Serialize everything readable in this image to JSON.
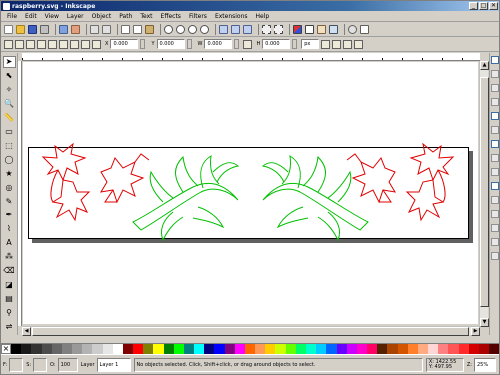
{
  "window": {
    "title": "raspberry.svg - Inkscape",
    "minimize_label": "_",
    "maximize_label": "□",
    "close_label": "✕"
  },
  "menu": [
    "File",
    "Edit",
    "View",
    "Layer",
    "Object",
    "Path",
    "Text",
    "Effects",
    "Filters",
    "Extensions",
    "Help"
  ],
  "toolbox": [
    "selector-tool",
    "node-tool",
    "tweak-tool",
    "zoom-tool",
    "measure-tool",
    "rect-tool",
    "box-3d-tool",
    "circle-tool",
    "star-tool",
    "spiral-tool",
    "pencil-tool",
    "pen-tool",
    "calligraphy-tool",
    "text-tool",
    "spray-tool",
    "eraser-tool",
    "bucket-tool",
    "gradient-tool",
    "dropper-tool",
    "connector-tool"
  ],
  "toolbox_glyphs": [
    "➤",
    "⬉",
    "✧",
    "🔍",
    "📏",
    "▭",
    "⬚",
    "◯",
    "★",
    "◎",
    "✎",
    "✒",
    "⌇",
    "A",
    "⁂",
    "⌫",
    "◪",
    "▤",
    "⚲",
    "⇌"
  ],
  "controls": {
    "x_label": "X",
    "x_value": "0.000",
    "y_label": "Y",
    "y_value": "0.000",
    "w_label": "W",
    "w_value": "0.000",
    "h_label": "H",
    "h_value": "0.000",
    "unit": "px"
  },
  "status": {
    "layer_label": "Layer",
    "layer_value": "Layer 1",
    "message": "No objects selected. Click, Shift+click, or drag around objects to select.",
    "coords_x": "X: 1422.55",
    "coords_y": "Y: 497.95",
    "zoom": "25%",
    "fill_label": "F:",
    "stroke_label": "S:",
    "opacity_label": "O:",
    "opacity_value": "100"
  },
  "colors": {
    "title_bar": "#0a246a",
    "flower_red": "#e00000",
    "leaf_green": "#00c000"
  },
  "palette": [
    "#000000",
    "#1a1a1a",
    "#333333",
    "#4d4d4d",
    "#666666",
    "#808080",
    "#999999",
    "#b3b3b3",
    "#cccccc",
    "#e6e6e6",
    "#ffffff",
    "#800000",
    "#ff0000",
    "#808000",
    "#ffff00",
    "#008000",
    "#00ff00",
    "#008080",
    "#00ffff",
    "#000080",
    "#0000ff",
    "#800080",
    "#ff00ff",
    "#ff6600",
    "#ff9955",
    "#ffcc00",
    "#ccff00",
    "#66ff00",
    "#00ff66",
    "#00ffcc",
    "#00ccff",
    "#0066ff",
    "#6600ff",
    "#cc00ff",
    "#ff00cc",
    "#ff0066",
    "#552200",
    "#aa4400",
    "#d45500",
    "#ff7f2a",
    "#ffaa80",
    "#ffd5d5",
    "#ff8080",
    "#ff5555",
    "#ff2a2a",
    "#d40000",
    "#aa0000",
    "#550000"
  ]
}
